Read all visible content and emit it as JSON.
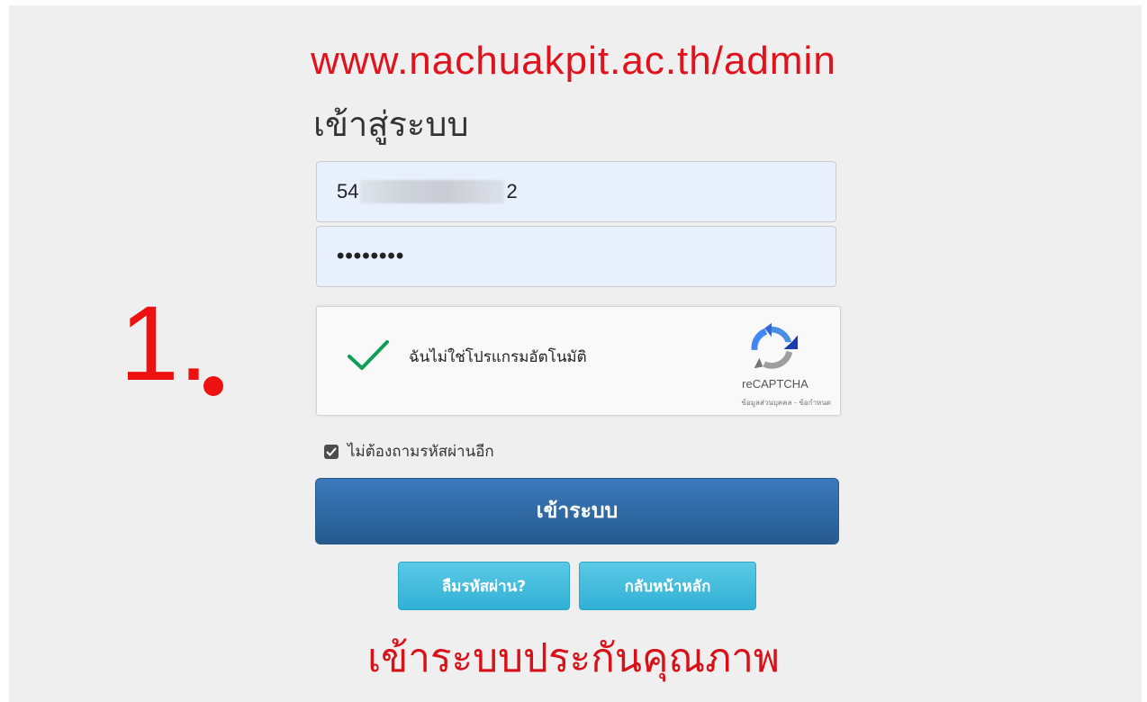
{
  "annotations": {
    "url": "www.nachuakpit.ac.th/admin",
    "step_number": "1.",
    "caption": "เข้าระบบประกันคุณภาพ"
  },
  "login_form": {
    "heading": "เข้าสู่ระบบ",
    "username_prefix": "54",
    "username_suffix": "2",
    "password_mask": "••••••••",
    "remember_label": "ไม่ต้องถามรหัสผ่านอีก",
    "remember_checked": true,
    "submit_label": "เข้าระบบ",
    "forgot_label": "ลืมรหัสผ่าน?",
    "home_label": "กลับหน้าหลัก"
  },
  "captcha": {
    "label": "ฉันไม่ใช่โปรแกรมอัตโนมัติ",
    "brand": "reCAPTCHA",
    "terms": "ข้อมูลส่วนบุคคล - ข้อกำหนด",
    "checked": true
  },
  "colors": {
    "annotation_red": "#e1121c",
    "button_blue": "#2f6aa6",
    "button_cyan": "#31b0d5",
    "check_green": "#0f9d58",
    "background": "#efefef"
  }
}
